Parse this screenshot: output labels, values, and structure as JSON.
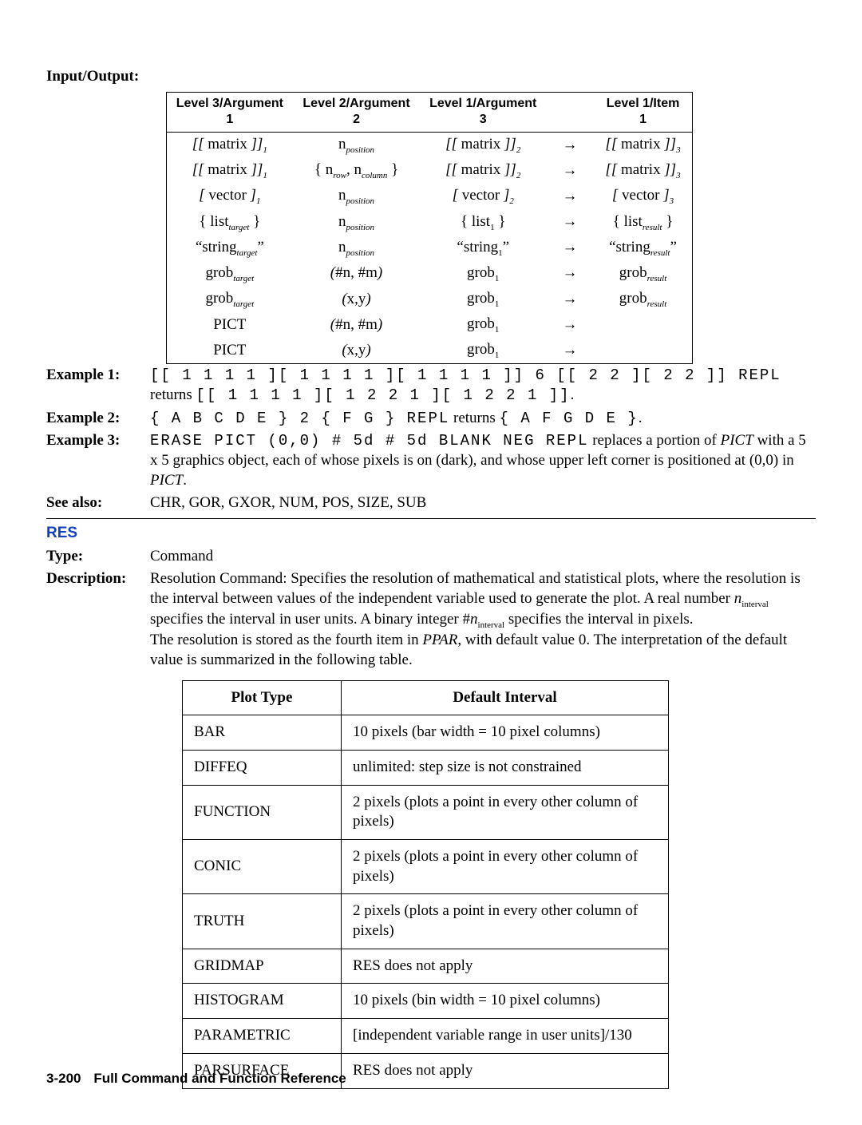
{
  "section": {
    "input_output_label": "Input/Output:",
    "io_headers": {
      "c1": "Level 3/Argument 1",
      "c2": "Level 2/Argument 2",
      "c3": "Level 1/Argument 3",
      "c4": "Level 1/Item 1"
    },
    "io_rows": [
      {
        "a": "[[ matrix ]]₁",
        "b": "nₚₒₛᵢₜᵢₒₙ",
        "c": "[[ matrix ]]₂",
        "d": "[[ matrix ]]₃"
      },
      {
        "a": "[[ matrix ]]₁",
        "b": "{ nᵣₒw, n꜀ₒₗᵤₘₙ }",
        "c": "[[ matrix ]]₂",
        "d": "[[ matrix ]]₃"
      },
      {
        "a": "[ vector ]₁",
        "b": "nₚₒₛᵢₜᵢₒₙ",
        "c": "[ vector ]₂",
        "d": "[ vector ]₃"
      },
      {
        "a": "{ listₜₐᵣgₑₜ }",
        "b": "nₚₒₛᵢₜᵢₒₙ",
        "c": "{ list₁ }",
        "d": "{ listᵣₑₛᵤₗₜ }"
      },
      {
        "a": "“stringₜₐᵣgₑₜ”",
        "b": "nₚₒₛᵢₜᵢₒₙ",
        "c": "“string₁”",
        "d": "“stringᵣₑₛᵤₗₜ”"
      },
      {
        "a": "grobₜₐᵣgₑₜ",
        "b": "(#n, #m)",
        "c": "grob₁",
        "d": "grobᵣₑₛᵤₗₜ"
      },
      {
        "a": "grobₜₐᵣgₑₜ",
        "b": "(x,y)",
        "c": "grob₁",
        "d": "grobᵣₑₛᵤₗₜ"
      },
      {
        "a": "PICT",
        "b": "(#n, #m)",
        "c": "grob₁",
        "d": ""
      },
      {
        "a": "PICT",
        "b": "(x,y)",
        "c": "grob₁",
        "d": ""
      }
    ],
    "example1_label": "Example 1:",
    "example1_line1": "[[ 1 1 1 1 ][ 1 1 1 1 ][ 1 1 1 1 ]] 6 [[ 2 2 ][ 2 2 ]] REPL",
    "example1_line2_pre": "returns ",
    "example1_line2_code": "[[ 1 1 1 1 ][ 1 2 2 1 ][ 1 2 2 1 ]]",
    "example1_line2_post": ".",
    "example2_label": "Example 2:",
    "example2_code1": "{ A B C D E } 2 { F G } REPL",
    "example2_mid": " returns ",
    "example2_code2": "{ A F G D E }",
    "example2_post": ".",
    "example3_label": "Example 3:",
    "example3_code": "ERASE PICT (0,0) # 5d # 5d BLANK NEG REPL",
    "example3_text": " replaces a portion of PICT with a 5 x 5 graphics object, each of whose pixels is on (dark), and whose upper left corner is positioned at (0,0) in PICT.",
    "seealso_label": "See also:",
    "seealso_text": "CHR, GOR, GXOR, NUM, POS, SIZE, SUB"
  },
  "res": {
    "heading": "RES",
    "type_label": "Type:",
    "type_value": "Command",
    "desc_label": "Description:",
    "desc_p1": "Resolution Command: Specifies the resolution of mathematical and statistical plots, where the resolution is the interval between values of the independent variable used to generate the plot. A real number nᵢₙₜₑᵣᵥₐₗ specifies the interval in user units. A binary integer #nᵢₙₜₑᵣᵥₐₗ specifies the interval in pixels.",
    "desc_p2": "The resolution is stored as the fourth item in PPAR, with default value 0. The interpretation of the default value is summarized in the following table.",
    "table_header": {
      "c1": "Plot Type",
      "c2": "Default Interval"
    },
    "table_rows": [
      {
        "t": "BAR",
        "d": "10 pixels (bar width = 10 pixel columns)"
      },
      {
        "t": "DIFFEQ",
        "d": "unlimited: step size is not constrained"
      },
      {
        "t": "FUNCTION",
        "d": "2 pixels (plots a point in every other column of pixels)"
      },
      {
        "t": "CONIC",
        "d": "2 pixels (plots a point in every other column of pixels)"
      },
      {
        "t": "TRUTH",
        "d": "2 pixels (plots a point in every other column of pixels)"
      },
      {
        "t": "GRIDMAP",
        "d": "RES does not apply"
      },
      {
        "t": "HISTOGRAM",
        "d": "10 pixels (bin width = 10 pixel columns)"
      },
      {
        "t": "PARAMETRIC",
        "d": "[independent variable range in user units]/130"
      },
      {
        "t": "PARSURFACE",
        "d": "RES does not apply"
      }
    ]
  },
  "footer": {
    "page": "3-200",
    "title": "Full Command and Function Reference"
  }
}
